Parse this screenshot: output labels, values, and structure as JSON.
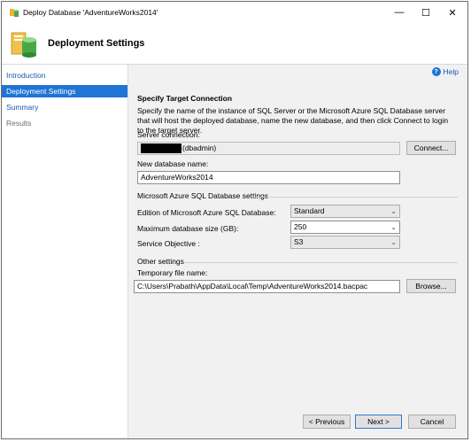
{
  "window": {
    "title": "Deploy Database 'AdventureWorks2014'",
    "controls": {
      "minimize": "—",
      "maximize": "☐",
      "close": "✕"
    }
  },
  "header": {
    "title": "Deployment Settings"
  },
  "sidebar": {
    "items": [
      {
        "label": "Introduction",
        "state": "link"
      },
      {
        "label": "Deployment Settings",
        "state": "active"
      },
      {
        "label": "Summary",
        "state": "link"
      },
      {
        "label": "Results",
        "state": "disabled"
      }
    ]
  },
  "main": {
    "help_label": "Help",
    "section_title": "Specify Target Connection",
    "description": "Specify the name of the instance of SQL Server or the Microsoft Azure SQL Database server that will host the deployed database, name the new database, and then click Connect to login to the target server.",
    "server_connection": {
      "label": "Server connection:",
      "value_suffix": "(dbadmin)",
      "connect_button": "Connect..."
    },
    "new_database": {
      "label": "New database name:",
      "value": "AdventureWorks2014"
    },
    "azure_settings": {
      "group_label": "Microsoft Azure SQL Database settings",
      "edition_label": "Edition of Microsoft Azure SQL Database:",
      "edition_value": "Standard",
      "maxsize_label": "Maximum database size (GB):",
      "maxsize_value": "250",
      "objective_label": "Service Objective :",
      "objective_value": "S3"
    },
    "other_settings": {
      "group_label": "Other settings",
      "temp_file_label": "Temporary file name:",
      "temp_file_value": "C:\\Users\\Prabath\\AppData\\Local\\Temp\\AdventureWorks2014.bacpac",
      "browse_button": "Browse..."
    }
  },
  "footer": {
    "previous": "< Previous",
    "next": "Next >",
    "cancel": "Cancel"
  },
  "colors": {
    "accent": "#1f74d6",
    "link": "#1a56b5",
    "panel": "#f1f1f1"
  }
}
